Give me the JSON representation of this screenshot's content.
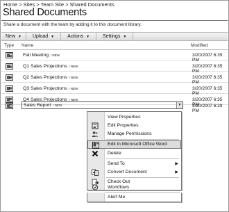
{
  "breadcrumb": "Home > Sites > Team Site > Shared Documents",
  "page_title": "Shared Documents",
  "description": "Share a document with the team by adding it to this document library.",
  "toolbar": {
    "new_label": "New",
    "upload_label": "Upload",
    "actions_label": "Actions",
    "settings_label": "Settings"
  },
  "columns": {
    "type": "Type",
    "name": "Name",
    "modified": "Modified"
  },
  "new_badge": "! NEW",
  "documents": [
    {
      "name": "Fall Meeting",
      "modified": "3/20/2007 6:35 PM"
    },
    {
      "name": "Q1 Sales Projections",
      "modified": "3/20/2007 6:35 PM"
    },
    {
      "name": "Q2 Sales Projections",
      "modified": "3/20/2007 6:35 PM"
    },
    {
      "name": "Q3 Sales Projections",
      "modified": "3/20/2007 6:35 PM"
    },
    {
      "name": "Q4 Sales Projections",
      "modified": "3/20/2007 6:35 PM"
    },
    {
      "name": "Sales Report",
      "modified": "3/20/2007 6:29 PM"
    }
  ],
  "context_menu": {
    "items": [
      {
        "label": "View Properties",
        "icon": "none-icon"
      },
      {
        "label": "Edit Properties",
        "icon": "properties-icon"
      },
      {
        "label": "Manage Permissions",
        "icon": "permissions-icon"
      },
      {
        "label": "Edit in Microsoft Office Word",
        "icon": "word-icon"
      },
      {
        "label": "Delete",
        "icon": "delete-x-icon"
      },
      {
        "label": "Send To",
        "icon": "none-icon"
      },
      {
        "label": "Convert Document",
        "icon": "convert-icon"
      },
      {
        "label": "Check Out",
        "icon": "checkout-icon"
      },
      {
        "label": "Workflows",
        "icon": "workflow-icon"
      },
      {
        "label": "Alert Me",
        "icon": "none-icon"
      }
    ]
  }
}
